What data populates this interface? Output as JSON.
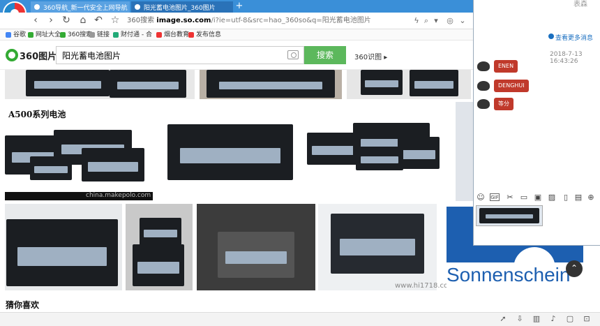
{
  "browser": {
    "tabs": [
      {
        "label": "360导航_新一代安全上网导航"
      },
      {
        "label": "阳光蓄电池图片_360图片"
      }
    ],
    "new_tab": "+",
    "url": {
      "prefix": "360搜索",
      "host": "image.so.com",
      "rest": "/i?ie=utf-8&src=hao_360so&q=阳光蓄电池图片"
    },
    "bookmarks": [
      {
        "label": "谷歌",
        "color": "#4285f4"
      },
      {
        "label": "网址大全",
        "color": "#3a3"
      },
      {
        "label": "360搜索",
        "color": "#3a3"
      },
      {
        "label": "链接",
        "color": "#999"
      },
      {
        "label": "财付通 - 合",
        "color": "#2a7"
      },
      {
        "label": "烟台教育",
        "color": "#e33"
      },
      {
        "label": "发布信息",
        "color": "#e33"
      }
    ]
  },
  "search": {
    "brand": "360图片",
    "query": "阳光蓄电池图片",
    "button": "搜索",
    "shitu": "360识图 ▸"
  },
  "results": {
    "section_title": "A500系列电池",
    "caption": "china.makepolo.com",
    "watermark": "www.hi1718.com",
    "guess": "猜你喜欢",
    "sonnen": "Sonnenschein"
  },
  "chat": {
    "title": "表森",
    "more": "查看更多消息",
    "time": "2018-7-13 16:43:26",
    "messages": [
      {
        "text": "ENEN"
      },
      {
        "text": "DENGHUI"
      },
      {
        "text": "等分"
      }
    ]
  },
  "colors": {
    "accent": "#3a8fd8",
    "search_button": "#5cb85c",
    "bubble": "#c0392b"
  }
}
